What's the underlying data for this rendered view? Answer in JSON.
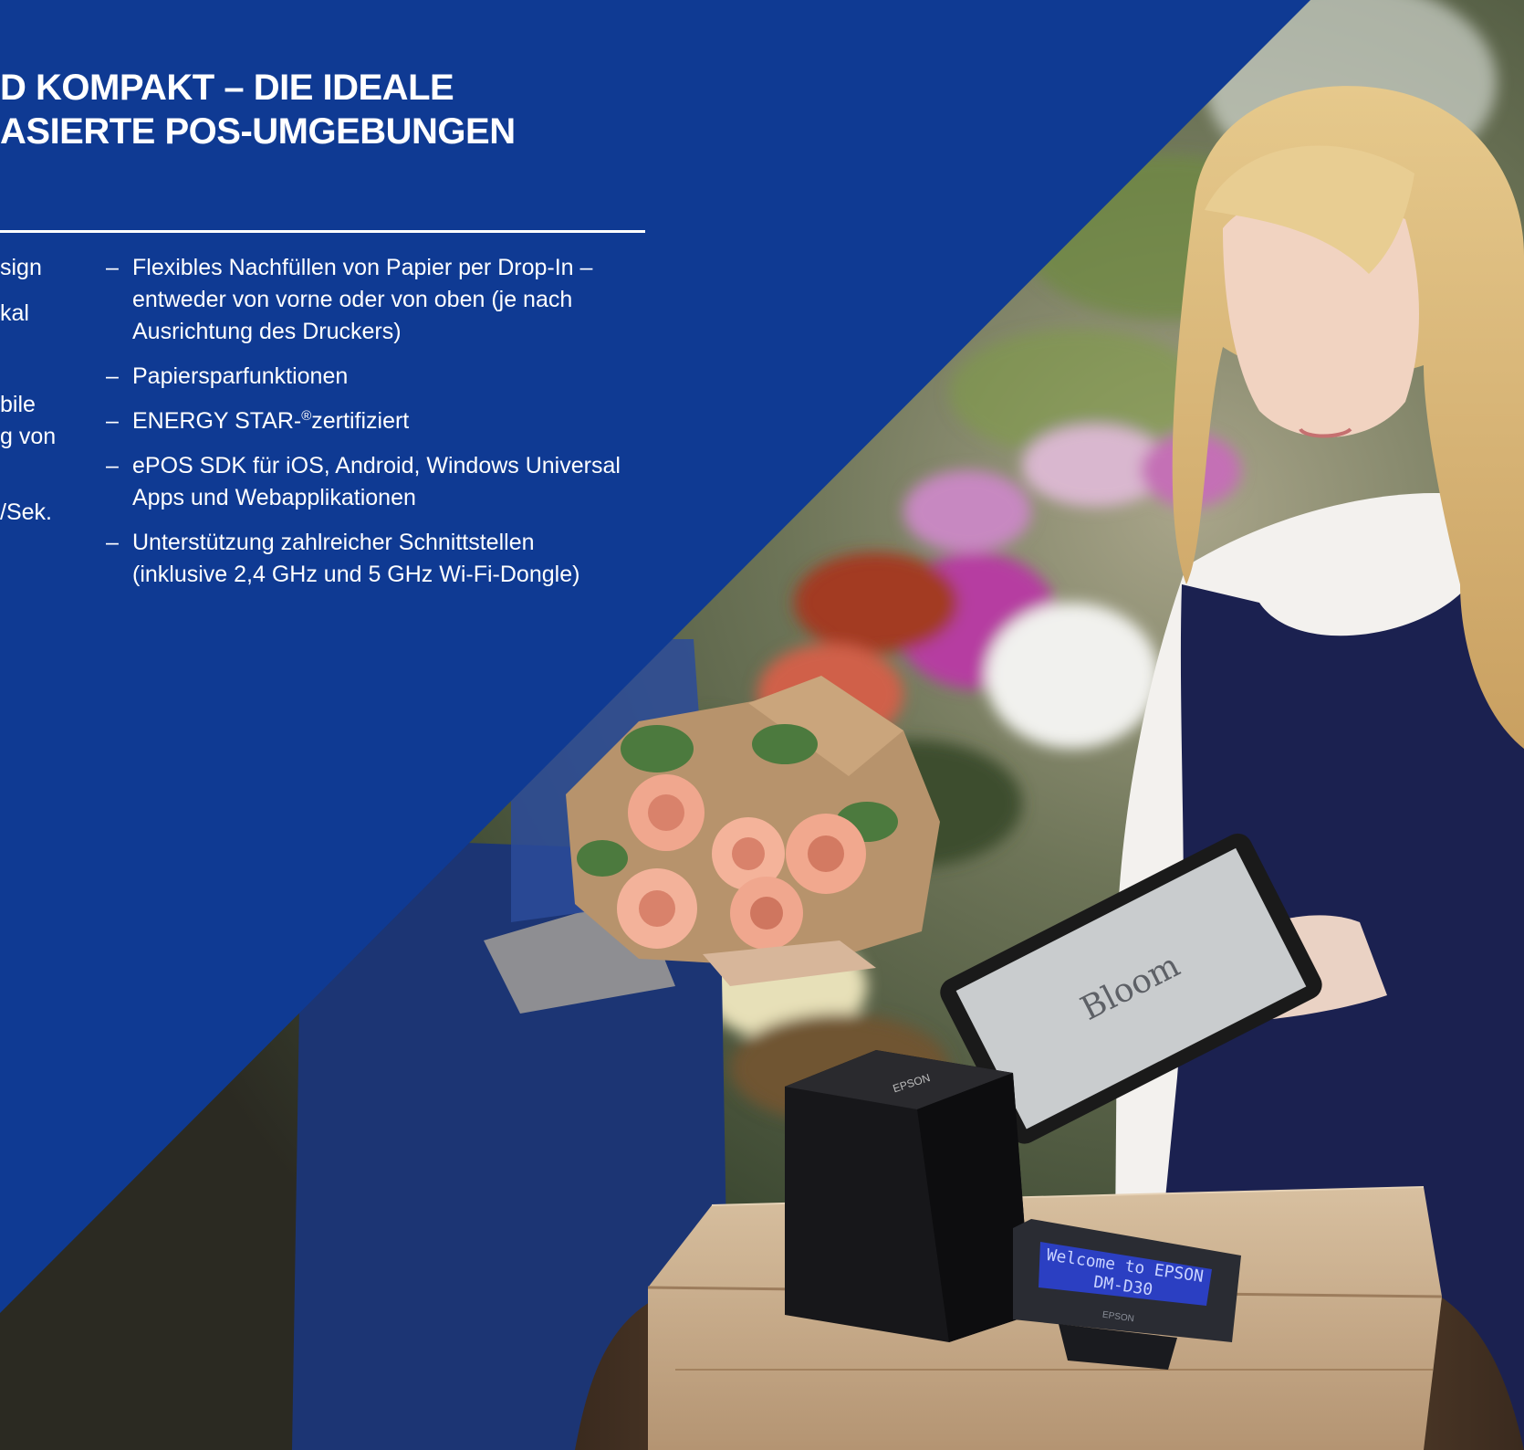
{
  "colors": {
    "panel_blue": "#0f3a93",
    "text": "#ffffff"
  },
  "headline": {
    "line1": "D KOMPAKT – DIE IDEALE",
    "line2": "ASIERTE POS-UMGEBUNGEN"
  },
  "left_column_fragments": [
    "sign",
    "kal",
    "bile",
    "g von",
    "/Sek."
  ],
  "features": {
    "bullet": "–",
    "items": [
      {
        "line1": "Flexibles Nachfüllen von Papier per Drop-In –",
        "line2": "entweder von vorne oder von oben (je nach",
        "line3": "Ausrichtung des Druckers)"
      },
      {
        "line1": "Papiersparfunktionen"
      },
      {
        "before": "ENERGY STAR-",
        "sup": "®",
        "after": "zertifiziert"
      },
      {
        "line1": "ePOS SDK für iOS, Android, Windows Universal",
        "line2": "Apps und Webapplikationen"
      },
      {
        "line1": "Unterstützung zahlreicher Schnittstellen",
        "line2": "(inklusive 2,4 GHz und 5 GHz Wi-Fi-Dongle)"
      }
    ]
  },
  "photo": {
    "description_icon": "florist-pos-photo",
    "display_text_line1": "Welcome to EPSON",
    "display_text_line2": "DM-D30",
    "display_brand": "EPSON",
    "printer_brand": "EPSON",
    "tablet_text": "Bloom"
  }
}
